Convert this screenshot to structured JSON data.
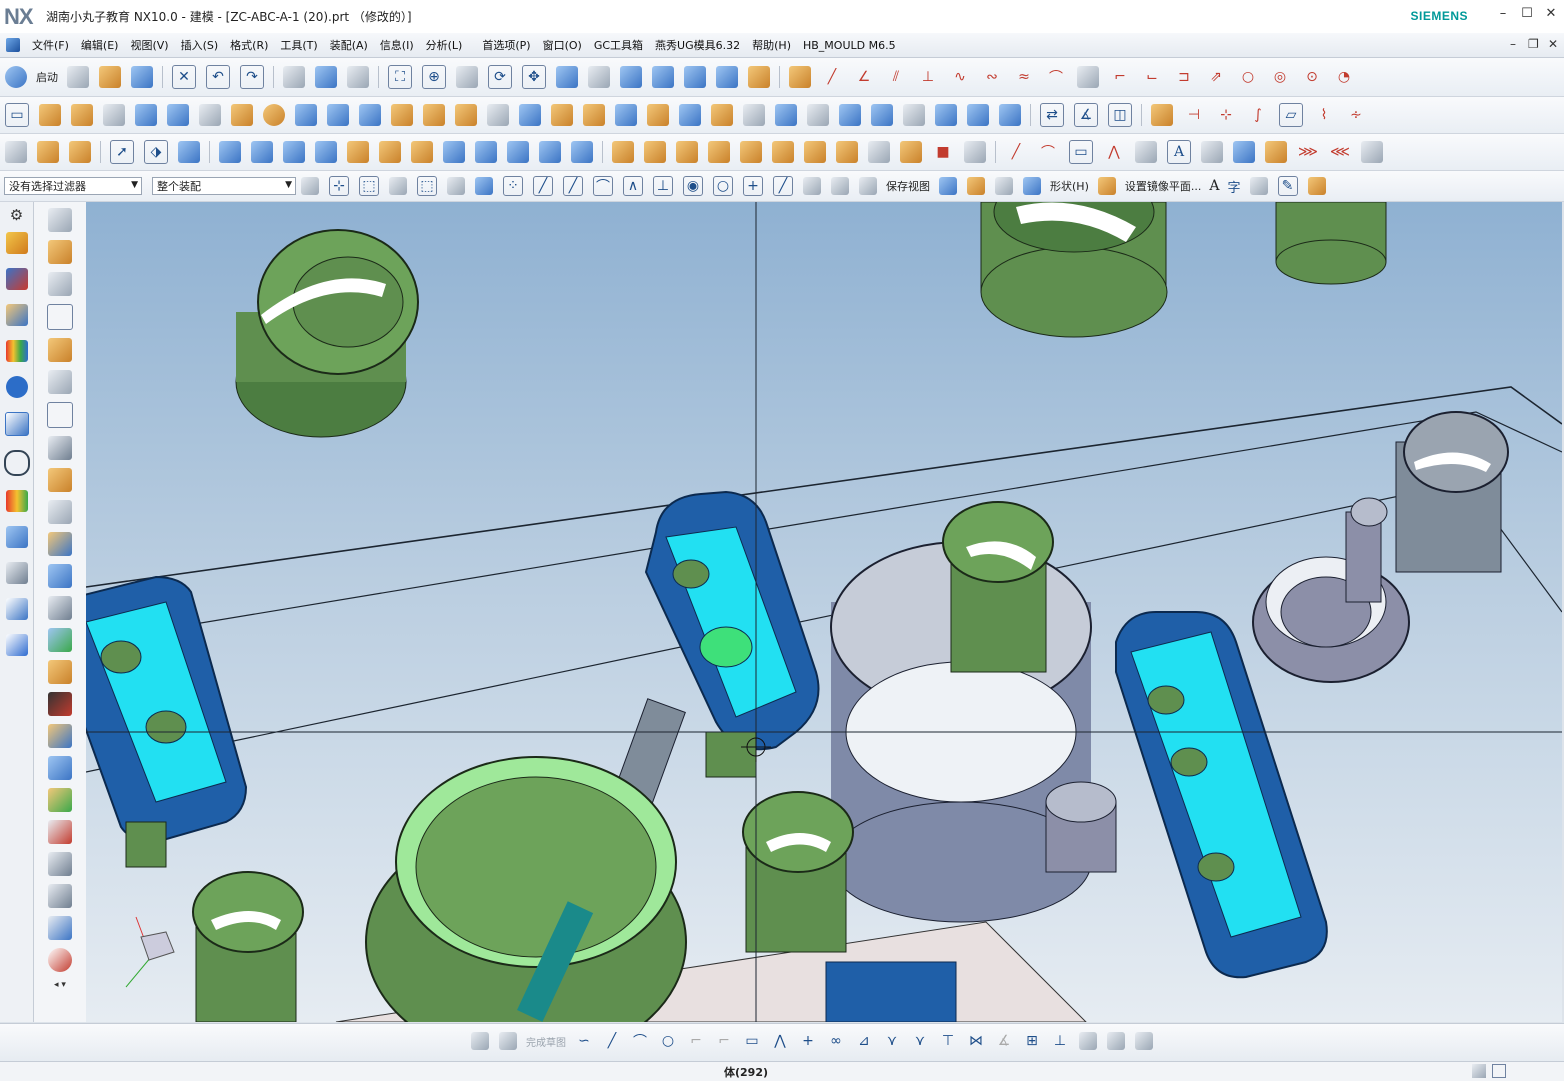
{
  "titlebar": {
    "logo": "NX",
    "title": "湖南小丸子教育 NX10.0 - 建模 - [ZC-ABC-A-1 (20).prt （修改的）]",
    "brand": "SIEMENS"
  },
  "menu": {
    "items": [
      "文件(F)",
      "编辑(E)",
      "视图(V)",
      "插入(S)",
      "格式(R)",
      "工具(T)",
      "装配(A)",
      "信息(I)",
      "分析(L)",
      "首选项(P)",
      "窗口(O)",
      "GC工具箱",
      "燕秀UG模具6.32",
      "帮助(H)",
      "HB_MOULD M6.5"
    ]
  },
  "toolbar1": {
    "start_label": "启动"
  },
  "toolbar4": {
    "filter_value": "没有选择过滤器",
    "scope_value": "整个装配",
    "save_view_label": "保存视图",
    "shape_label": "形状(H)",
    "mirror_label": "设置镜像平面...",
    "text_glyph": "A",
    "char_glyph": "字"
  },
  "bottom": {
    "finish_sketch_label": "完成草图"
  },
  "status": {
    "text": "体(292)"
  },
  "colors": {
    "green_body": "#5f8f4f",
    "dark_blue_body": "#1f5fa8",
    "cyan_face": "#22e0f2",
    "gray_body": "#8c8fa8",
    "light_green_ring": "#9fe89a"
  }
}
